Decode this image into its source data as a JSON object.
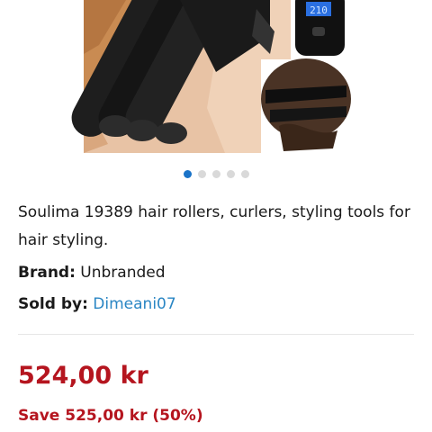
{
  "product": {
    "title": "Soulima 19389 hair rollers, curlers, styling tools for hair styling.",
    "brand_label": "Brand:",
    "brand_value": "Unbranded",
    "sold_label": "Sold by:",
    "seller": "Dimeani07"
  },
  "gallery": {
    "display_temp": "210",
    "active_index": 1,
    "count": 5
  },
  "pricing": {
    "price": "524,00 kr",
    "save": "Save 525,00 kr (50%)"
  },
  "colors": {
    "price_red": "#b5151f",
    "link_blue": "#2a86c4",
    "dot_active": "#1a73c8"
  }
}
